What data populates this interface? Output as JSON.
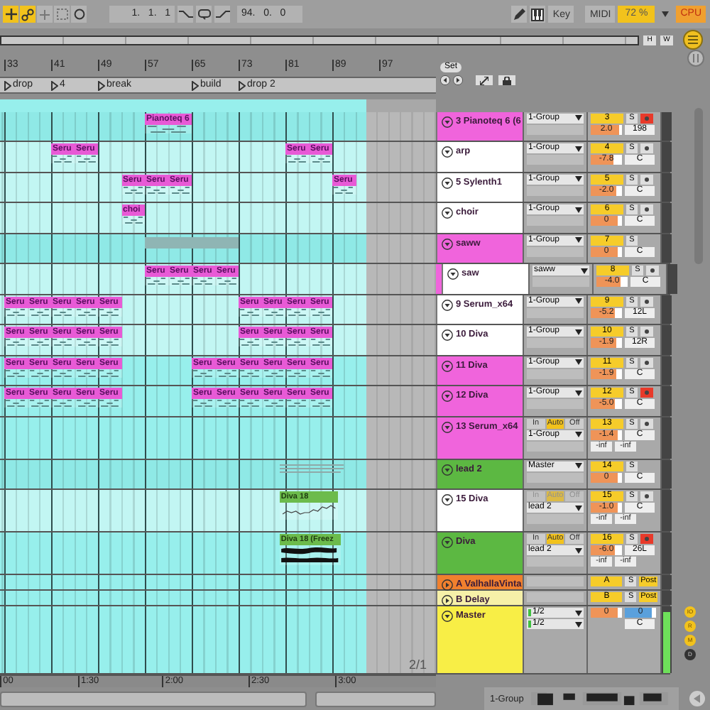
{
  "toolbar": {
    "buttons": [
      {
        "kind": "add",
        "on": true
      },
      {
        "kind": "link",
        "on": true
      },
      {
        "kind": "plus",
        "on": false
      },
      {
        "kind": "frame",
        "on": false
      },
      {
        "kind": "circle",
        "on": false
      }
    ],
    "position": "1.   1.   1",
    "loop_length": "94.   0.   0",
    "key": "Key",
    "midi": "MIDI",
    "cpu_load": "72 %",
    "cpu": "CPU"
  },
  "overview": {
    "buttons": [
      "H",
      "W"
    ]
  },
  "ruler": {
    "bars": [
      "33",
      "41",
      "49",
      "57",
      "65",
      "73",
      "81",
      "89",
      "97"
    ]
  },
  "locators": [
    {
      "label": "drop"
    },
    {
      "label": "4"
    },
    {
      "label": "break"
    },
    {
      "label": "build"
    },
    {
      "label": "drop 2"
    }
  ],
  "set_button": "Set",
  "tracks": [
    {
      "name": "3 Pianoteq 6 (6",
      "kind": "group",
      "color": "#f064dc",
      "expanded": true,
      "routing": "1-Group",
      "number": "3",
      "solo": "S",
      "armed": true,
      "volume": "2.0",
      "level": 0.92,
      "pan": "198",
      "clips": [
        {
          "label": "Pianoteq 6",
          "kind": "midi",
          "color": "#e85ad6"
        }
      ]
    },
    {
      "name": "arp",
      "kind": "track",
      "color": "#ffffff",
      "expanded": true,
      "routing": "1-Group",
      "number": "4",
      "solo": "S",
      "armed": false,
      "volume": "-7.8",
      "level": 0.72,
      "pan": "C",
      "clips": [
        {
          "label": "Seru",
          "kind": "midi",
          "color": "#e85ad6"
        },
        {
          "label": "Seru",
          "kind": "midi",
          "color": "#e85ad6"
        },
        {
          "label": "Seru",
          "kind": "midi",
          "color": "#e85ad6"
        },
        {
          "label": "Seru",
          "kind": "midi",
          "color": "#e85ad6"
        }
      ]
    },
    {
      "name": "5 Sylenth1",
      "kind": "track",
      "color": "#ffffff",
      "expanded": true,
      "routing": "1-Group",
      "number": "5",
      "solo": "S",
      "armed": false,
      "volume": "-2.0",
      "level": 0.84,
      "pan": "C",
      "clips": [
        {
          "label": "Seru",
          "kind": "midi",
          "color": "#e85ad6"
        },
        {
          "label": "Seru",
          "kind": "midi",
          "color": "#e85ad6"
        },
        {
          "label": "Seru",
          "kind": "midi",
          "color": "#e85ad6"
        },
        {
          "label": "Seru",
          "kind": "midi",
          "color": "#e85ad6"
        }
      ]
    },
    {
      "name": "choir",
      "kind": "track",
      "color": "#ffffff",
      "expanded": true,
      "routing": "1-Group",
      "number": "6",
      "solo": "S",
      "armed": false,
      "volume": "0",
      "level": 0.88,
      "pan": "C",
      "clips": [
        {
          "label": "choi",
          "kind": "midi",
          "color": "#e85ad6"
        }
      ]
    },
    {
      "name": "saww",
      "kind": "group",
      "color": "#f064dc",
      "expanded": true,
      "routing": "1-Group",
      "number": "7",
      "solo": "S",
      "volume": "0",
      "level": 0.88,
      "pan": "C",
      "clips": [
        {
          "kind": "summary",
          "color": "#8fb5b4"
        }
      ],
      "children": [
        {
          "name": "saw",
          "kind": "track",
          "color": "#ffffff",
          "expanded": true,
          "routing": "saww",
          "number": "8",
          "solo": "S",
          "armed": false,
          "volume": "-4.0",
          "level": 0.78,
          "pan": "C",
          "clips": [
            {
              "label": "Seru",
              "kind": "midi",
              "color": "#e85ad6"
            },
            {
              "label": "Seru",
              "kind": "midi",
              "color": "#e85ad6"
            },
            {
              "label": "Seru",
              "kind": "midi",
              "color": "#e85ad6"
            },
            {
              "label": "Seru",
              "kind": "midi",
              "color": "#e85ad6"
            }
          ]
        }
      ]
    },
    {
      "name": "9 Serum_x64",
      "kind": "track",
      "color": "#ffffff",
      "expanded": true,
      "routing": "1-Group",
      "number": "9",
      "solo": "S",
      "armed": false,
      "volume": "-5.2",
      "level": 0.76,
      "pan": "12L",
      "clips": [
        {
          "label": "Seru",
          "kind": "midi",
          "color": "#e85ad6"
        },
        {
          "label": "Seru",
          "kind": "midi",
          "color": "#e85ad6"
        },
        {
          "label": "Seru",
          "kind": "midi",
          "color": "#e85ad6"
        },
        {
          "label": "Seru",
          "kind": "midi",
          "color": "#e85ad6"
        },
        {
          "label": "Seru",
          "kind": "midi",
          "color": "#e85ad6"
        },
        {
          "label": "Seru",
          "kind": "midi",
          "color": "#e85ad6"
        },
        {
          "label": "Seru",
          "kind": "midi",
          "color": "#e85ad6"
        },
        {
          "label": "Seru",
          "kind": "midi",
          "color": "#e85ad6"
        },
        {
          "label": "Seru",
          "kind": "midi",
          "color": "#e85ad6"
        }
      ]
    },
    {
      "name": "10 Diva",
      "kind": "track",
      "color": "#ffffff",
      "expanded": true,
      "routing": "1-Group",
      "number": "10",
      "solo": "S",
      "armed": false,
      "volume": "-1.9",
      "level": 0.84,
      "pan": "12R",
      "clips": [
        {
          "label": "Seru",
          "kind": "midi",
          "color": "#e85ad6"
        },
        {
          "label": "Seru",
          "kind": "midi",
          "color": "#e85ad6"
        },
        {
          "label": "Seru",
          "kind": "midi",
          "color": "#e85ad6"
        },
        {
          "label": "Seru",
          "kind": "midi",
          "color": "#e85ad6"
        },
        {
          "label": "Seru",
          "kind": "midi",
          "color": "#e85ad6"
        },
        {
          "label": "Seru",
          "kind": "midi",
          "color": "#e85ad6"
        },
        {
          "label": "Seru",
          "kind": "midi",
          "color": "#e85ad6"
        },
        {
          "label": "Seru",
          "kind": "midi",
          "color": "#e85ad6"
        },
        {
          "label": "Seru",
          "kind": "midi",
          "color": "#e85ad6"
        }
      ]
    },
    {
      "name": "11 Diva",
      "kind": "track",
      "color": "#f064dc",
      "expanded": true,
      "routing": "1-Group",
      "number": "11",
      "solo": "S",
      "armed": false,
      "volume": "-1.9",
      "level": 0.84,
      "pan": "C",
      "clips": [
        {
          "label": "Seru",
          "kind": "midi",
          "color": "#e85ad6"
        },
        {
          "label": "Seru",
          "kind": "midi",
          "color": "#e85ad6"
        },
        {
          "label": "Seru",
          "kind": "midi",
          "color": "#e85ad6"
        },
        {
          "label": "Seru",
          "kind": "midi",
          "color": "#e85ad6"
        },
        {
          "label": "Seru",
          "kind": "midi",
          "color": "#e85ad6"
        },
        {
          "label": "Seru",
          "kind": "midi",
          "color": "#e85ad6"
        },
        {
          "label": "Seru",
          "kind": "midi",
          "color": "#e85ad6"
        },
        {
          "label": "Seru",
          "kind": "midi",
          "color": "#e85ad6"
        },
        {
          "label": "Seru",
          "kind": "midi",
          "color": "#e85ad6"
        },
        {
          "label": "Seru",
          "kind": "midi",
          "color": "#e85ad6"
        },
        {
          "label": "Seru",
          "kind": "midi",
          "color": "#e85ad6"
        }
      ]
    },
    {
      "name": "12 Diva",
      "kind": "track",
      "color": "#f064dc",
      "expanded": true,
      "routing": "1-Group",
      "number": "12",
      "solo": "S",
      "armed": true,
      "volume": "-5.0",
      "level": 0.78,
      "pan": "C",
      "clips": [
        {
          "label": "Seru",
          "kind": "midi",
          "color": "#e85ad6"
        },
        {
          "label": "Seru",
          "kind": "midi",
          "color": "#e85ad6"
        },
        {
          "label": "Seru",
          "kind": "midi",
          "color": "#e85ad6"
        },
        {
          "label": "Seru",
          "kind": "midi",
          "color": "#e85ad6"
        },
        {
          "label": "Seru",
          "kind": "midi",
          "color": "#e85ad6"
        },
        {
          "label": "Seru",
          "kind": "midi",
          "color": "#e85ad6"
        },
        {
          "label": "Seru",
          "kind": "midi",
          "color": "#e85ad6"
        },
        {
          "label": "Seru",
          "kind": "midi",
          "color": "#e85ad6"
        },
        {
          "label": "Seru",
          "kind": "midi",
          "color": "#e85ad6"
        },
        {
          "label": "Seru",
          "kind": "midi",
          "color": "#e85ad6"
        },
        {
          "label": "Seru",
          "kind": "midi",
          "color": "#e85ad6"
        }
      ]
    },
    {
      "name": "13 Serum_x64",
      "kind": "track",
      "color": "#f064dc",
      "expanded": true,
      "monitor": {
        "disabled": false,
        "options": [
          {
            "label": "In",
            "selected": false
          },
          {
            "label": "Auto",
            "selected": true
          },
          {
            "label": "Off",
            "selected": false
          }
        ]
      },
      "routing": "1-Group",
      "number": "13",
      "solo": "S",
      "armed": false,
      "volume": "-1.4",
      "level": 0.86,
      "pan": "C",
      "peaks": [
        "-inf",
        "-inf"
      ]
    },
    {
      "name": "lead 2",
      "kind": "group",
      "color": "#5cb842",
      "expanded": true,
      "routing": "Master",
      "number": "14",
      "solo": "S",
      "volume": "0",
      "level": 0.88,
      "pan": "C",
      "clips": [
        {
          "kind": "lines",
          "color": "#8fa9a8"
        }
      ]
    },
    {
      "name": "15 Diva",
      "kind": "track",
      "color": "#ffffff",
      "expanded": true,
      "monitor": {
        "disabled": true,
        "options": [
          {
            "label": "In",
            "selected": false
          },
          {
            "label": "Auto",
            "selected": true
          },
          {
            "label": "Off",
            "selected": false
          }
        ]
      },
      "routing": "lead 2",
      "number": "15",
      "solo": "S",
      "armed": false,
      "volume": "-1.0",
      "level": 0.86,
      "pan": "C",
      "peaks": [
        "-inf",
        "-inf"
      ],
      "clips": [
        {
          "label": "Diva 18",
          "kind": "automation",
          "color": "#6cbb4c"
        }
      ]
    },
    {
      "name": "Diva",
      "kind": "track",
      "color": "#5cb842",
      "expanded": true,
      "monitor": {
        "disabled": false,
        "options": [
          {
            "label": "In",
            "selected": false
          },
          {
            "label": "Auto",
            "selected": true
          },
          {
            "label": "Off",
            "selected": false
          }
        ]
      },
      "routing": "lead 2",
      "number": "16",
      "solo": "S",
      "armed": true,
      "volume": "-6.0",
      "level": 0.76,
      "pan": "26L",
      "peaks": [
        "-inf",
        "-inf"
      ],
      "clips": [
        {
          "label": "Diva 18 (Freez",
          "kind": "audio",
          "color": "#6cbb4c"
        }
      ]
    },
    {
      "name": "A ValhallaVinta",
      "kind": "return",
      "color": "#f0802e",
      "expanded": false,
      "number": "A",
      "solo": "S",
      "send": "Post"
    },
    {
      "name": "B Delay",
      "kind": "return",
      "color": "#f6f0a8",
      "expanded": false,
      "number": "B",
      "solo": "S",
      "send": "Post"
    },
    {
      "name": "Master",
      "kind": "master",
      "color": "#f8ee46",
      "expanded": true,
      "outputs": [
        "1/2",
        "1/2"
      ],
      "volume": "0",
      "level": 0.85,
      "cue": {
        "text": "0",
        "level": 0.85
      },
      "pan": "C",
      "meter": {
        "level": 0.92
      }
    }
  ],
  "page_indicator": "2/1",
  "time_ruler": [
    {
      "label": "00"
    },
    {
      "label": "1:30"
    },
    {
      "label": "2:00"
    },
    {
      "label": "2:30"
    },
    {
      "label": "3:00"
    }
  ],
  "master_buttons": [
    "IO",
    "R",
    "M",
    "D"
  ],
  "bottom": {
    "group_label": "1-Group"
  }
}
